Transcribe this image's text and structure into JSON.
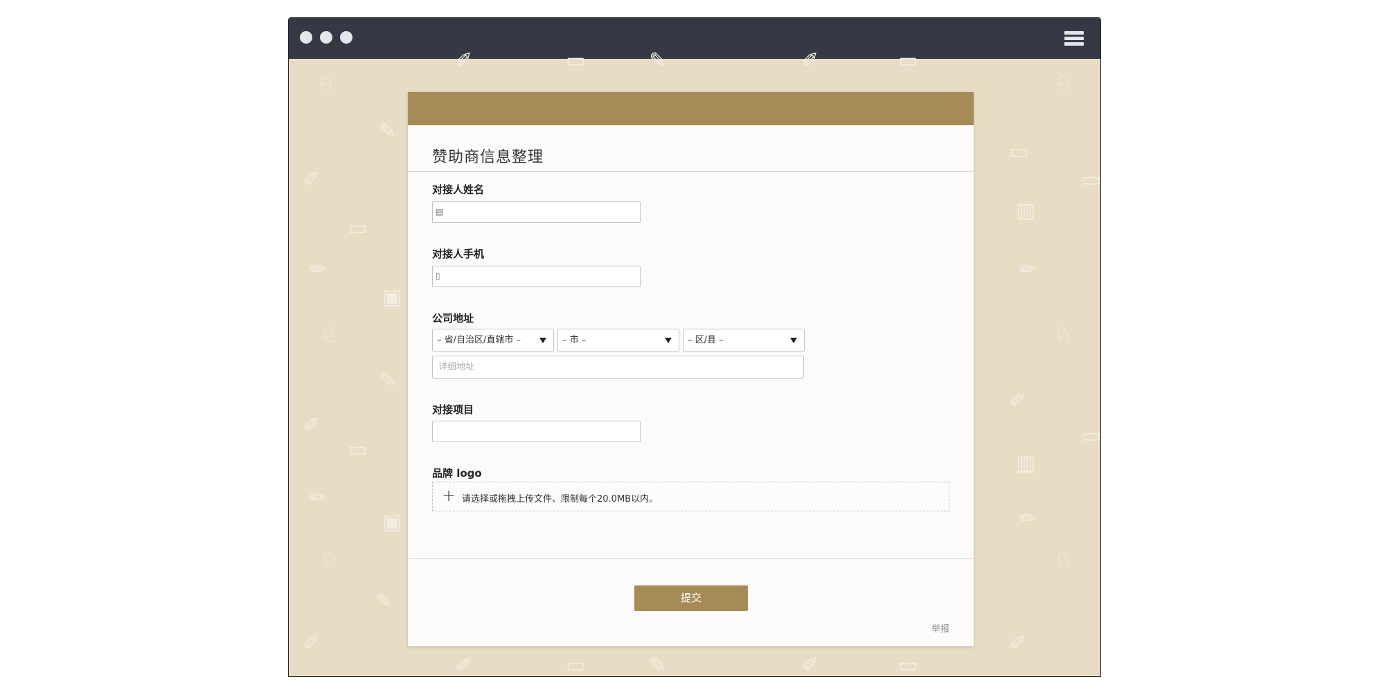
{
  "window": {
    "controls": [
      "close-dot",
      "minimize-dot",
      "maximize-dot"
    ],
    "menu_icon": "hamburger-menu-icon"
  },
  "form": {
    "title": "赞助商信息整理",
    "fields": {
      "contact_name": {
        "label": "对接人姓名",
        "icon": "contact-card-icon",
        "value": ""
      },
      "contact_phone": {
        "label": "对接人手机",
        "icon": "mobile-phone-icon",
        "value": ""
      },
      "company_address": {
        "label": "公司地址",
        "province_select": "– 省/自治区/直辖市 –",
        "city_select": "– 市 –",
        "district_select": "– 区/县 –",
        "detail_placeholder": "详细地址"
      },
      "project": {
        "label": "对接项目",
        "value": ""
      },
      "brand_logo": {
        "label": "品牌 logo",
        "upload_hint": "请选择或拖拽上传文件、限制每个20.0MB以内。"
      }
    },
    "submit_label": "提交",
    "report_label": "举报"
  },
  "colors": {
    "accent": "#a58c57",
    "background": "#e8dcc4",
    "titlebar": "#343945"
  }
}
